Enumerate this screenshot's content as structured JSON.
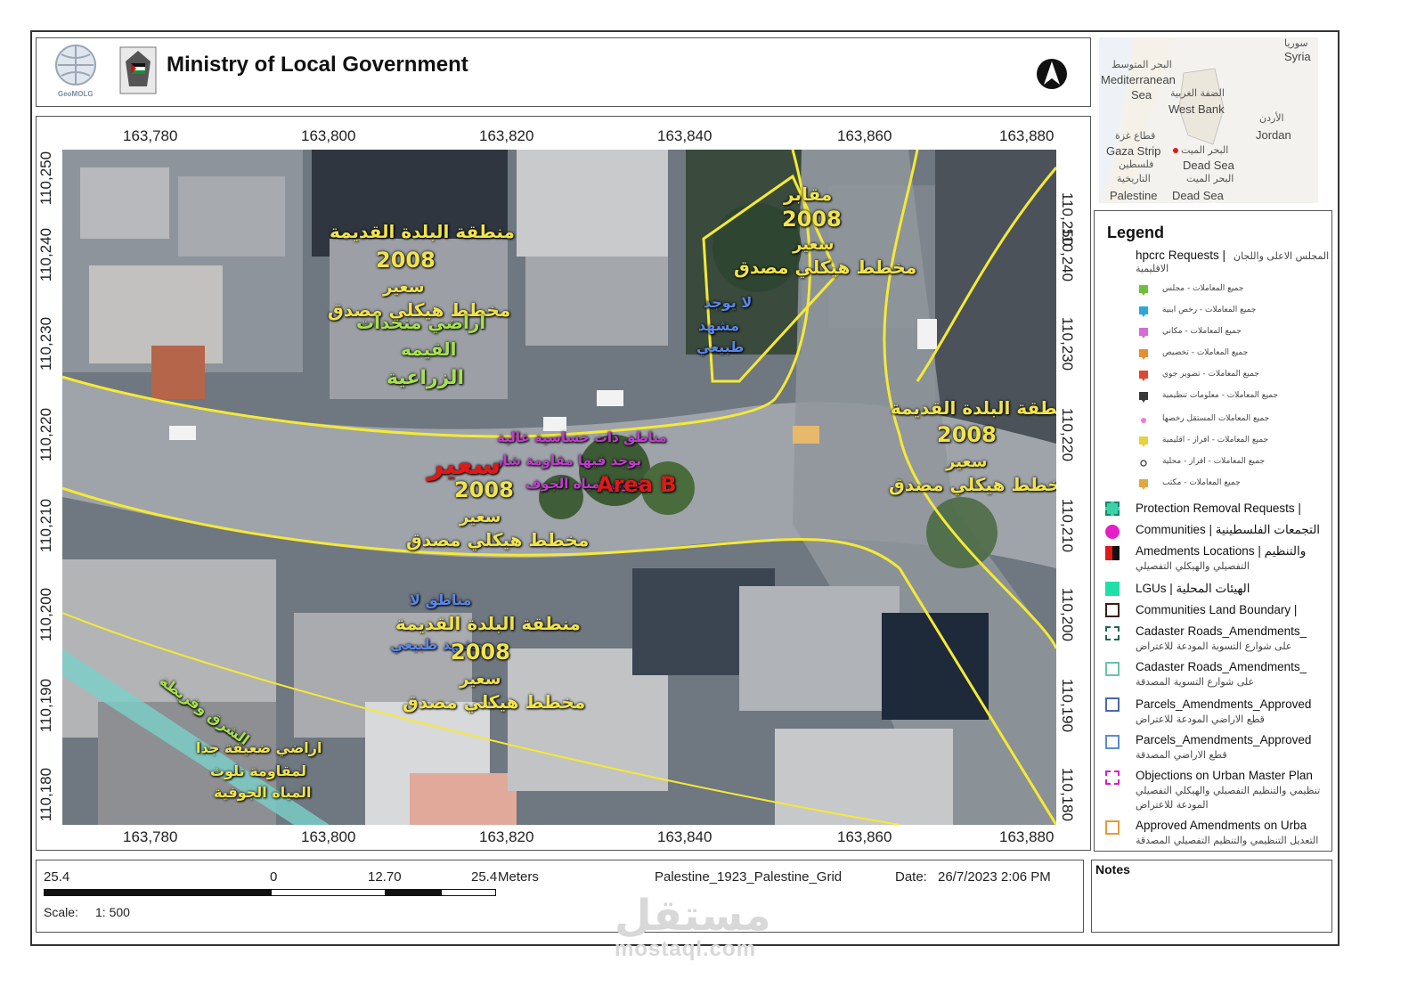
{
  "header": {
    "title": "Ministry of Local Government",
    "logo_left_caption": "GeoMOLG",
    "logo_left_icon": "geomolg-globe-logo",
    "logo_right_icon": "palestine-emblem-logo",
    "north_arrow_icon": "north-arrow-icon"
  },
  "inset_map": {
    "labels": {
      "syria_ar": "سوريا",
      "syria": "Syria",
      "med_ar": "البحر المتوسط",
      "mediterranean": "Mediterranean",
      "sea": "Sea",
      "westbank_ar": "الضفة الغربية",
      "westbank": "West Bank",
      "jordan_ar": "الأردن",
      "jordan": "Jordan",
      "gaza_ar": "قطاع غزة",
      "gaza": "Gaza Strip",
      "deadsea_ar": "البحر الميت",
      "deadsea": "Dead Sea",
      "palestine_ar": "فلسطين",
      "historic_ar": "التاريخية",
      "palestine": "Palestine",
      "deadsea2_ar": "البحر الميت",
      "deadsea2": "Dead Sea"
    }
  },
  "map": {
    "x_ticks": [
      "163,780",
      "163,800",
      "163,820",
      "163,840",
      "163,860",
      "163,880"
    ],
    "y_ticks": [
      "110,250",
      "110,240",
      "110,230",
      "110,220",
      "110,210",
      "110,200",
      "110,190",
      "110,180"
    ],
    "annotations": {
      "old_town_nw": "منطقة البلدة القديمة",
      "year_nw": "2008",
      "saeer_nw": "سعير",
      "approved_plan_nw": "مخطط هيكلي مصدق",
      "agri_1": "اراضي منحدات",
      "agri_2": "القيمه",
      "agri_3": "الزراعية",
      "cemetery": "مقابر",
      "year_cem": "2008",
      "saeer_cem": "سعير",
      "approved_plan_cem": "مخطط هيكلي مصدق",
      "no_scene_1": "لا يوجد",
      "no_scene_2": "مشهد",
      "no_scene_3": "طبيعي",
      "old_town_e": "منطقة البلدة القديمة",
      "year_e": "2008",
      "saeer_e": "سعير",
      "approved_plan_e": "مخطط هيكلي مصدق",
      "high_sens_1": "مناطق ذات حساسية عالية",
      "high_sens_2": "يوجد فيها مقاومة شار",
      "high_sens_3": "حيوي لمياه الجوف",
      "saeer_big": "سعير",
      "area_b": "Area B",
      "year_c": "2008",
      "saeer_c": "سعير",
      "approved_plan_c": "مخطط هيكلي مصدق",
      "no_area_1": "مناطق لا",
      "old_town_s": "منطقة البلدة القديمة",
      "no_area_2": "مشهد طبيعي",
      "year_s": "2008",
      "saeer_s": "سعير",
      "approved_plan_s": "مخطط هيكلي مصدق",
      "weak_1": "اراضي ضعيفة جدا",
      "weak_2": "لمقاومة تلوث",
      "weak_3": "المياه الجوفية",
      "road_label": "الشرق وقريطة"
    }
  },
  "legend": {
    "title": "Legend",
    "hpcrc": "hpcrc Requests |",
    "hpcrc_ar": "طلبات المجلس الاعلى واللجان",
    "hpcrc_ar2": "الاقليمية",
    "sub_items": [
      {
        "label": "جميع المعاملات - مجلس",
        "color": "#6fbf3b",
        "icon": "pin-icon"
      },
      {
        "label": "جميع المعاملات - رخص ابنية",
        "color": "#2aa7d8",
        "icon": "pin-icon"
      },
      {
        "label": "جميع المعاملات - مكاني",
        "color": "#d66ad8",
        "icon": "pin-icon"
      },
      {
        "label": "جميع المعاملات - تخصيص",
        "color": "#e5902d",
        "icon": "pin-icon"
      },
      {
        "label": "جميع المعاملات - تصوير جوي",
        "color": "#e0472f",
        "icon": "pin-icon"
      },
      {
        "label": "جميع المعاملات - معلومات تنظيمية",
        "color": "#3a3a3a",
        "icon": "pin-icon"
      },
      {
        "label": "جميع المعاملات المستقل رخصها",
        "color": "#f07ad8",
        "icon": "dot-icon"
      },
      {
        "label": "جميع المعاملات - افراز - اقليمية",
        "color": "#e6d23a",
        "icon": "pin-icon"
      },
      {
        "label": "جميع المعاملات - افراز - محلية",
        "color": "#555555",
        "icon": "ring-icon"
      },
      {
        "label": "جميع المعاملات - مكتب",
        "color": "#e0a841",
        "icon": "pin-icon"
      }
    ],
    "items": [
      {
        "label": "Protection Removal Requests | ",
        "label2": "",
        "swatch": "protection-swatch"
      },
      {
        "label": "Communities |  التجمعات الفلسطينية",
        "label2": "",
        "swatch": "communities-swatch"
      },
      {
        "label": "Amedments Locations |  والتنظيم",
        "label2": "التفصيلي والهيكلي التفصيلي",
        "swatch": "amendments-swatch"
      },
      {
        "label": "LGUs | الهيئات المحلية",
        "label2": "",
        "swatch": "lgus-swatch"
      },
      {
        "label": "Communities Land Boundary | ",
        "label2": "",
        "swatch": "land-boundary-swatch"
      },
      {
        "label": "Cadaster Roads_Amendments_",
        "label2": "على شوارع التسوية المودعة للاعتراض",
        "swatch": "cad-roads-objection-swatch"
      },
      {
        "label": "Cadaster Roads_Amendments_",
        "label2": "على شوارع التسوية المصدقة",
        "swatch": "cad-roads-approved-swatch"
      },
      {
        "label": "Parcels_Amendments_Approved",
        "label2": "قطع الاراضي المودعة للاعتراض",
        "swatch": "parcels-objection-swatch"
      },
      {
        "label": "Parcels_Amendments_Approved",
        "label2": "قطع الاراضي المصدقة",
        "swatch": "parcels-approved-swatch"
      },
      {
        "label": "Objections on Urban Master Plan",
        "label2": "تنظيمي والتنظيم التفصيلي والهيكلي التفصيلي",
        "label3": "المودعة للاعتراض",
        "swatch": "objections-swatch"
      },
      {
        "label": "Approved Amendments on Urba",
        "label2": "التعديل التنظيمي والتنظيم التفصيلي المصدقة",
        "swatch": "approved-amend-swatch"
      }
    ]
  },
  "scalebar": {
    "left_value": "25.4",
    "zero": "0",
    "mid_value": "12.70",
    "right_value": "25.4",
    "unit": "Meters",
    "scale_label": "Scale:",
    "scale_value": "1: 500"
  },
  "footer": {
    "projection": "Palestine_1923_Palestine_Grid",
    "date_label": "Date:",
    "date_value": "26/7/2023 2:06 PM"
  },
  "notes": {
    "title": "Notes"
  },
  "watermark": {
    "ar": "مستقل",
    "en": "mostaql.com"
  }
}
